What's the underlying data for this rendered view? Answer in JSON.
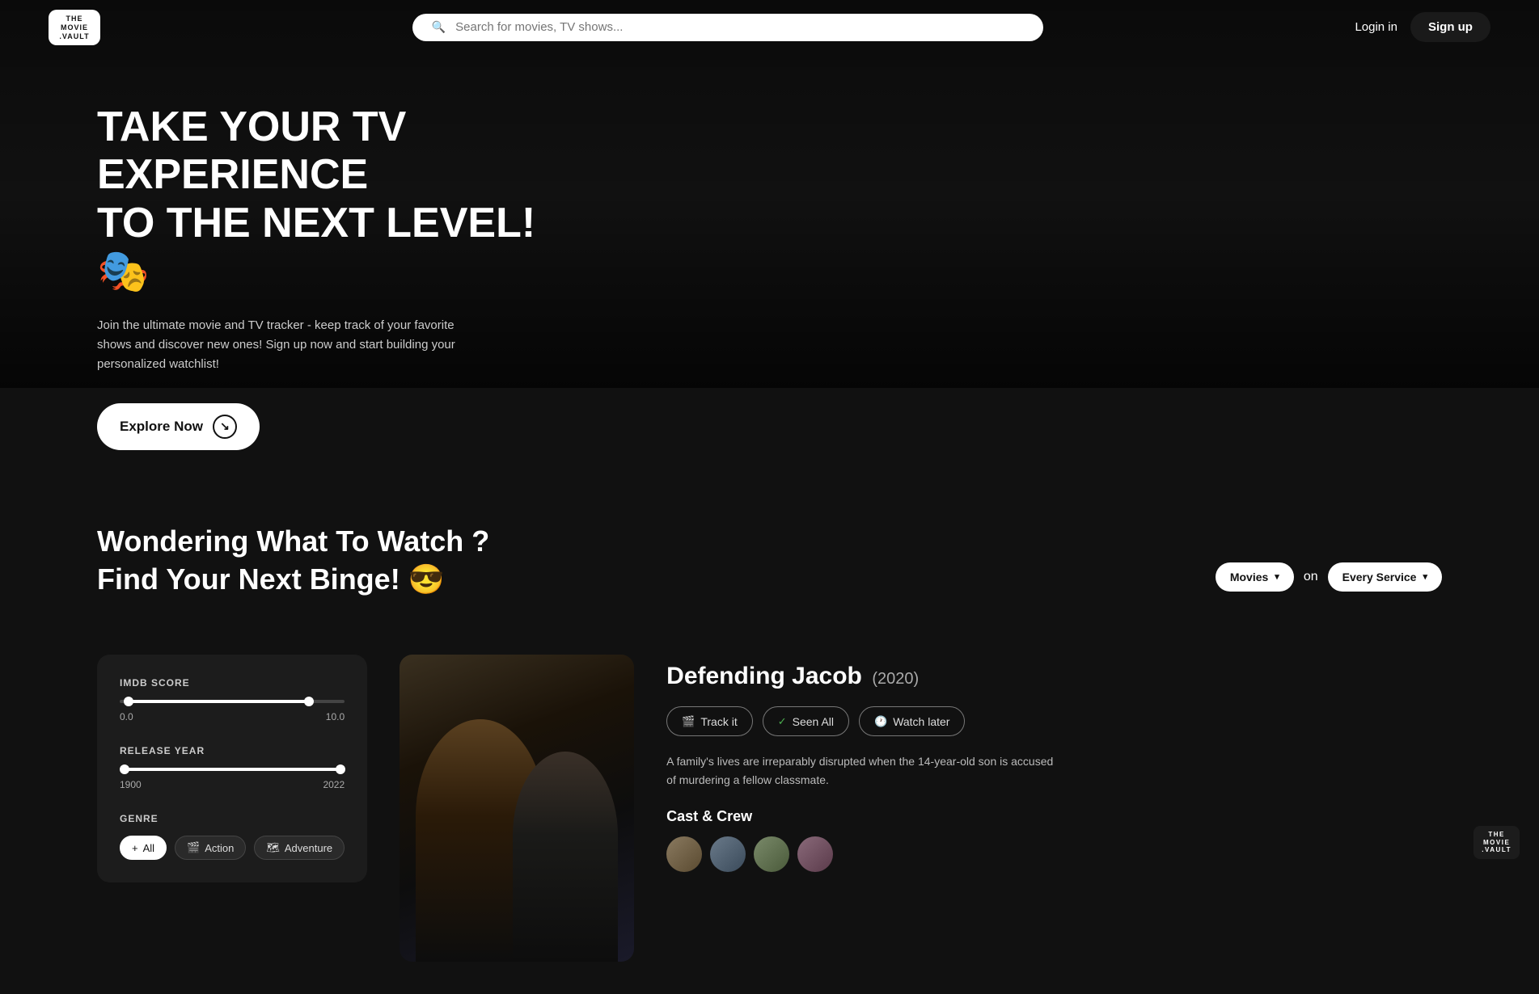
{
  "logo": {
    "line1": "THE",
    "line2": "MOVIE",
    "dot": ".VAULT"
  },
  "navbar": {
    "search_placeholder": "Search for movies, TV shows...",
    "login_label": "Login in",
    "signup_label": "Sign up"
  },
  "hero": {
    "title_line1": "TAKE YOUR TV EXPERIENCE",
    "title_line2": "TO THE NEXT LEVEL! 🎭",
    "subtitle": "Join the ultimate movie and TV tracker - keep track of your favorite shows and discover new ones! Sign up now and start building your personalized watchlist!",
    "explore_btn": "Explore Now"
  },
  "binge_section": {
    "title_line1": "Wondering What To Watch ?",
    "title_line2": "Find Your Next Binge! 😎",
    "filter_type_label": "Movies",
    "on_label": "on",
    "service_label": "Every Service"
  },
  "filters": {
    "imdb_label": "IMDB SCORE",
    "imdb_min": "0.0",
    "imdb_max": "10.0",
    "year_label": "RELEASE YEAR",
    "year_min": "1900",
    "year_max": "2022",
    "genre_label": "GENRE",
    "genres": [
      {
        "label": "All",
        "active": true
      },
      {
        "label": "Action",
        "active": false
      },
      {
        "label": "Adventure",
        "active": false
      }
    ]
  },
  "movie": {
    "title": "Defending Jacob",
    "year": "(2020)",
    "actions": {
      "track": "Track it",
      "seen": "Seen All",
      "watch_later": "Watch later"
    },
    "description": "A family's lives are irreparably disrupted when the 14-year-old son is accused of murdering a fellow classmate.",
    "cast_label": "Cast & Crew"
  },
  "bottom_logo": {
    "line1": "THE",
    "line2": "MOVIE",
    "dot": ".VAULT"
  }
}
